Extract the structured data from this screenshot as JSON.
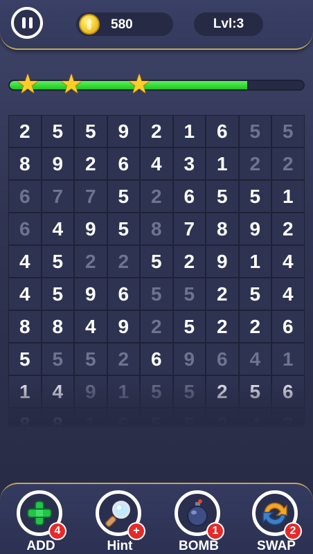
{
  "header": {
    "coins": "580",
    "level": "Lvl:3"
  },
  "progress": {
    "fill_fraction": 0.81,
    "stars": 3
  },
  "grid": {
    "columns": 9,
    "rows": [
      [
        [
          "2",
          0
        ],
        [
          "5",
          0
        ],
        [
          "5",
          0
        ],
        [
          "9",
          0
        ],
        [
          "2",
          0
        ],
        [
          "1",
          0
        ],
        [
          "6",
          0
        ],
        [
          "5",
          1
        ],
        [
          "5",
          1
        ]
      ],
      [
        [
          "8",
          0
        ],
        [
          "9",
          0
        ],
        [
          "2",
          0
        ],
        [
          "6",
          0
        ],
        [
          "4",
          0
        ],
        [
          "3",
          0
        ],
        [
          "1",
          0
        ],
        [
          "2",
          1
        ],
        [
          "2",
          1
        ]
      ],
      [
        [
          "6",
          1
        ],
        [
          "7",
          1
        ],
        [
          "7",
          1
        ],
        [
          "5",
          0
        ],
        [
          "2",
          1
        ],
        [
          "6",
          0
        ],
        [
          "5",
          0
        ],
        [
          "5",
          0
        ],
        [
          "1",
          0
        ]
      ],
      [
        [
          "6",
          1
        ],
        [
          "4",
          0
        ],
        [
          "9",
          0
        ],
        [
          "5",
          0
        ],
        [
          "8",
          1
        ],
        [
          "7",
          0
        ],
        [
          "8",
          0
        ],
        [
          "9",
          0
        ],
        [
          "2",
          0
        ]
      ],
      [
        [
          "4",
          0
        ],
        [
          "5",
          0
        ],
        [
          "2",
          1
        ],
        [
          "2",
          1
        ],
        [
          "5",
          0
        ],
        [
          "2",
          0
        ],
        [
          "9",
          0
        ],
        [
          "1",
          0
        ],
        [
          "4",
          0
        ]
      ],
      [
        [
          "4",
          0
        ],
        [
          "5",
          0
        ],
        [
          "9",
          0
        ],
        [
          "6",
          0
        ],
        [
          "5",
          1
        ],
        [
          "5",
          1
        ],
        [
          "2",
          0
        ],
        [
          "5",
          0
        ],
        [
          "4",
          0
        ]
      ],
      [
        [
          "8",
          0
        ],
        [
          "8",
          0
        ],
        [
          "4",
          0
        ],
        [
          "9",
          0
        ],
        [
          "2",
          1
        ],
        [
          "5",
          0
        ],
        [
          "2",
          0
        ],
        [
          "2",
          0
        ],
        [
          "6",
          0
        ]
      ],
      [
        [
          "5",
          0
        ],
        [
          "5",
          1
        ],
        [
          "5",
          1
        ],
        [
          "2",
          1
        ],
        [
          "6",
          0
        ],
        [
          "9",
          1
        ],
        [
          "6",
          1
        ],
        [
          "4",
          1
        ],
        [
          "1",
          1
        ]
      ],
      [
        [
          "1",
          0
        ],
        [
          "4",
          0
        ],
        [
          "9",
          1
        ],
        [
          "1",
          1
        ],
        [
          "5",
          1
        ],
        [
          "5",
          1
        ],
        [
          "2",
          0
        ],
        [
          "5",
          0
        ],
        [
          "6",
          0
        ]
      ],
      [
        [
          "8",
          0
        ],
        [
          "8",
          0
        ],
        [
          "1",
          1
        ],
        [
          "6",
          1
        ],
        [
          "5",
          1
        ],
        [
          "5",
          1
        ],
        [
          "2",
          1
        ],
        [
          "4",
          1
        ],
        [
          "3",
          1
        ]
      ]
    ]
  },
  "boosters": [
    {
      "label": "ADD",
      "badge": "4",
      "icon": "plus-icon"
    },
    {
      "label": "Hint",
      "badge": "+",
      "icon": "magnifier-icon"
    },
    {
      "label": "BOMB",
      "badge": "1",
      "icon": "bomb-icon"
    },
    {
      "label": "SWAP",
      "badge": "2",
      "icon": "swap-icon"
    }
  ],
  "colors": {
    "progress": "#2ed82e",
    "star": "#ffcd2a",
    "badge": "#e52a2a"
  }
}
